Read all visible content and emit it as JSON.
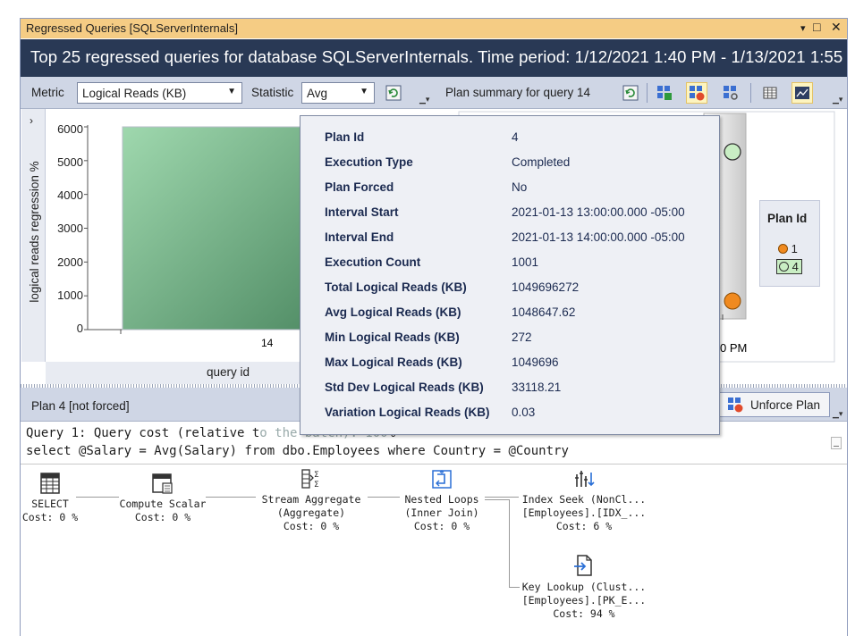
{
  "window": {
    "title": "Regressed Queries [SQLServerInternals]",
    "controls": {
      "dropdown": "▾",
      "maximize": "□",
      "close": "✕"
    }
  },
  "report_header": "Top 25 regressed queries for database SQLServerInternals. Time period: 1/12/2021 1:40 PM - 1/13/2021 1:55 PM",
  "left_toolbar": {
    "metric_label": "Metric",
    "metric_value": "Logical Reads (KB)",
    "statistic_label": "Statistic",
    "statistic_value": "Avg"
  },
  "right_toolbar": {
    "title": "Plan summary for query 14"
  },
  "left_chart": {
    "ylabel": "logical reads regression %",
    "xlabel": "query id",
    "yticks": [
      "6000",
      "5000",
      "4000",
      "3000",
      "2000",
      "1000",
      "0"
    ],
    "xtick": "14"
  },
  "chart_data": {
    "type": "bar",
    "categories": [
      "14"
    ],
    "values": [
      6000
    ],
    "xlabel": "query id",
    "ylabel": "logical reads regression %",
    "ylim": [
      0,
      6000
    ],
    "bar_color": "#4f9468"
  },
  "right_chart": {
    "xtick_partial": "0 PM",
    "legend_title": "Plan Id",
    "legend_items": [
      {
        "label": "1",
        "color": "#f08a1f"
      },
      {
        "label": "4",
        "color": "#c9eec4"
      }
    ]
  },
  "plan_bar": {
    "title": "Plan 4 [not forced]",
    "unforce_label": "Unforce Plan"
  },
  "query_text": {
    "line1_visible_left": "Query 1: Query cost (relative t",
    "line1_visible_right": "%",
    "line1_hidden_fragment": "o the batch): 100",
    "line2": "select @Salary = Avg(Salary) from dbo.Employees where Country = @Country"
  },
  "plan": {
    "select": {
      "name": "SELECT",
      "cost": "Cost: 0 %"
    },
    "compute_scalar": {
      "name": "Compute Scalar",
      "cost": "Cost: 0 %"
    },
    "stream_aggregate": {
      "name": "Stream Aggregate",
      "sub": "(Aggregate)",
      "cost": "Cost: 0 %"
    },
    "nested_loops": {
      "name": "Nested Loops",
      "sub": "(Inner Join)",
      "cost": "Cost: 0 %"
    },
    "index_seek": {
      "name": "Index Seek (NonCl...",
      "sub": "[Employees].[IDX_...",
      "cost": "Cost: 6 %"
    },
    "key_lookup": {
      "name": "Key Lookup (Clust...",
      "sub": "[Employees].[PK_E...",
      "cost": "Cost: 94 %"
    }
  },
  "tooltip": {
    "rows": [
      {
        "k": "Plan Id",
        "v": "4"
      },
      {
        "k": "Execution Type",
        "v": "Completed"
      },
      {
        "k": "Plan Forced",
        "v": "No"
      },
      {
        "k": "Interval Start",
        "v": "2021-01-13 13:00:00.000 -05:00"
      },
      {
        "k": "Interval End",
        "v": "2021-01-13 14:00:00.000 -05:00"
      },
      {
        "k": "Execution Count",
        "v": "1001"
      },
      {
        "k": "Total Logical Reads (KB)",
        "v": "1049696272"
      },
      {
        "k": "Avg Logical Reads (KB)",
        "v": "1048647.62"
      },
      {
        "k": "Min Logical Reads (KB)",
        "v": "272"
      },
      {
        "k": "Max Logical Reads (KB)",
        "v": "1049696"
      },
      {
        "k": "Std Dev Logical Reads (KB)",
        "v": "33118.21"
      },
      {
        "k": "Variation Logical Reads (KB)",
        "v": "0.03"
      }
    ]
  }
}
